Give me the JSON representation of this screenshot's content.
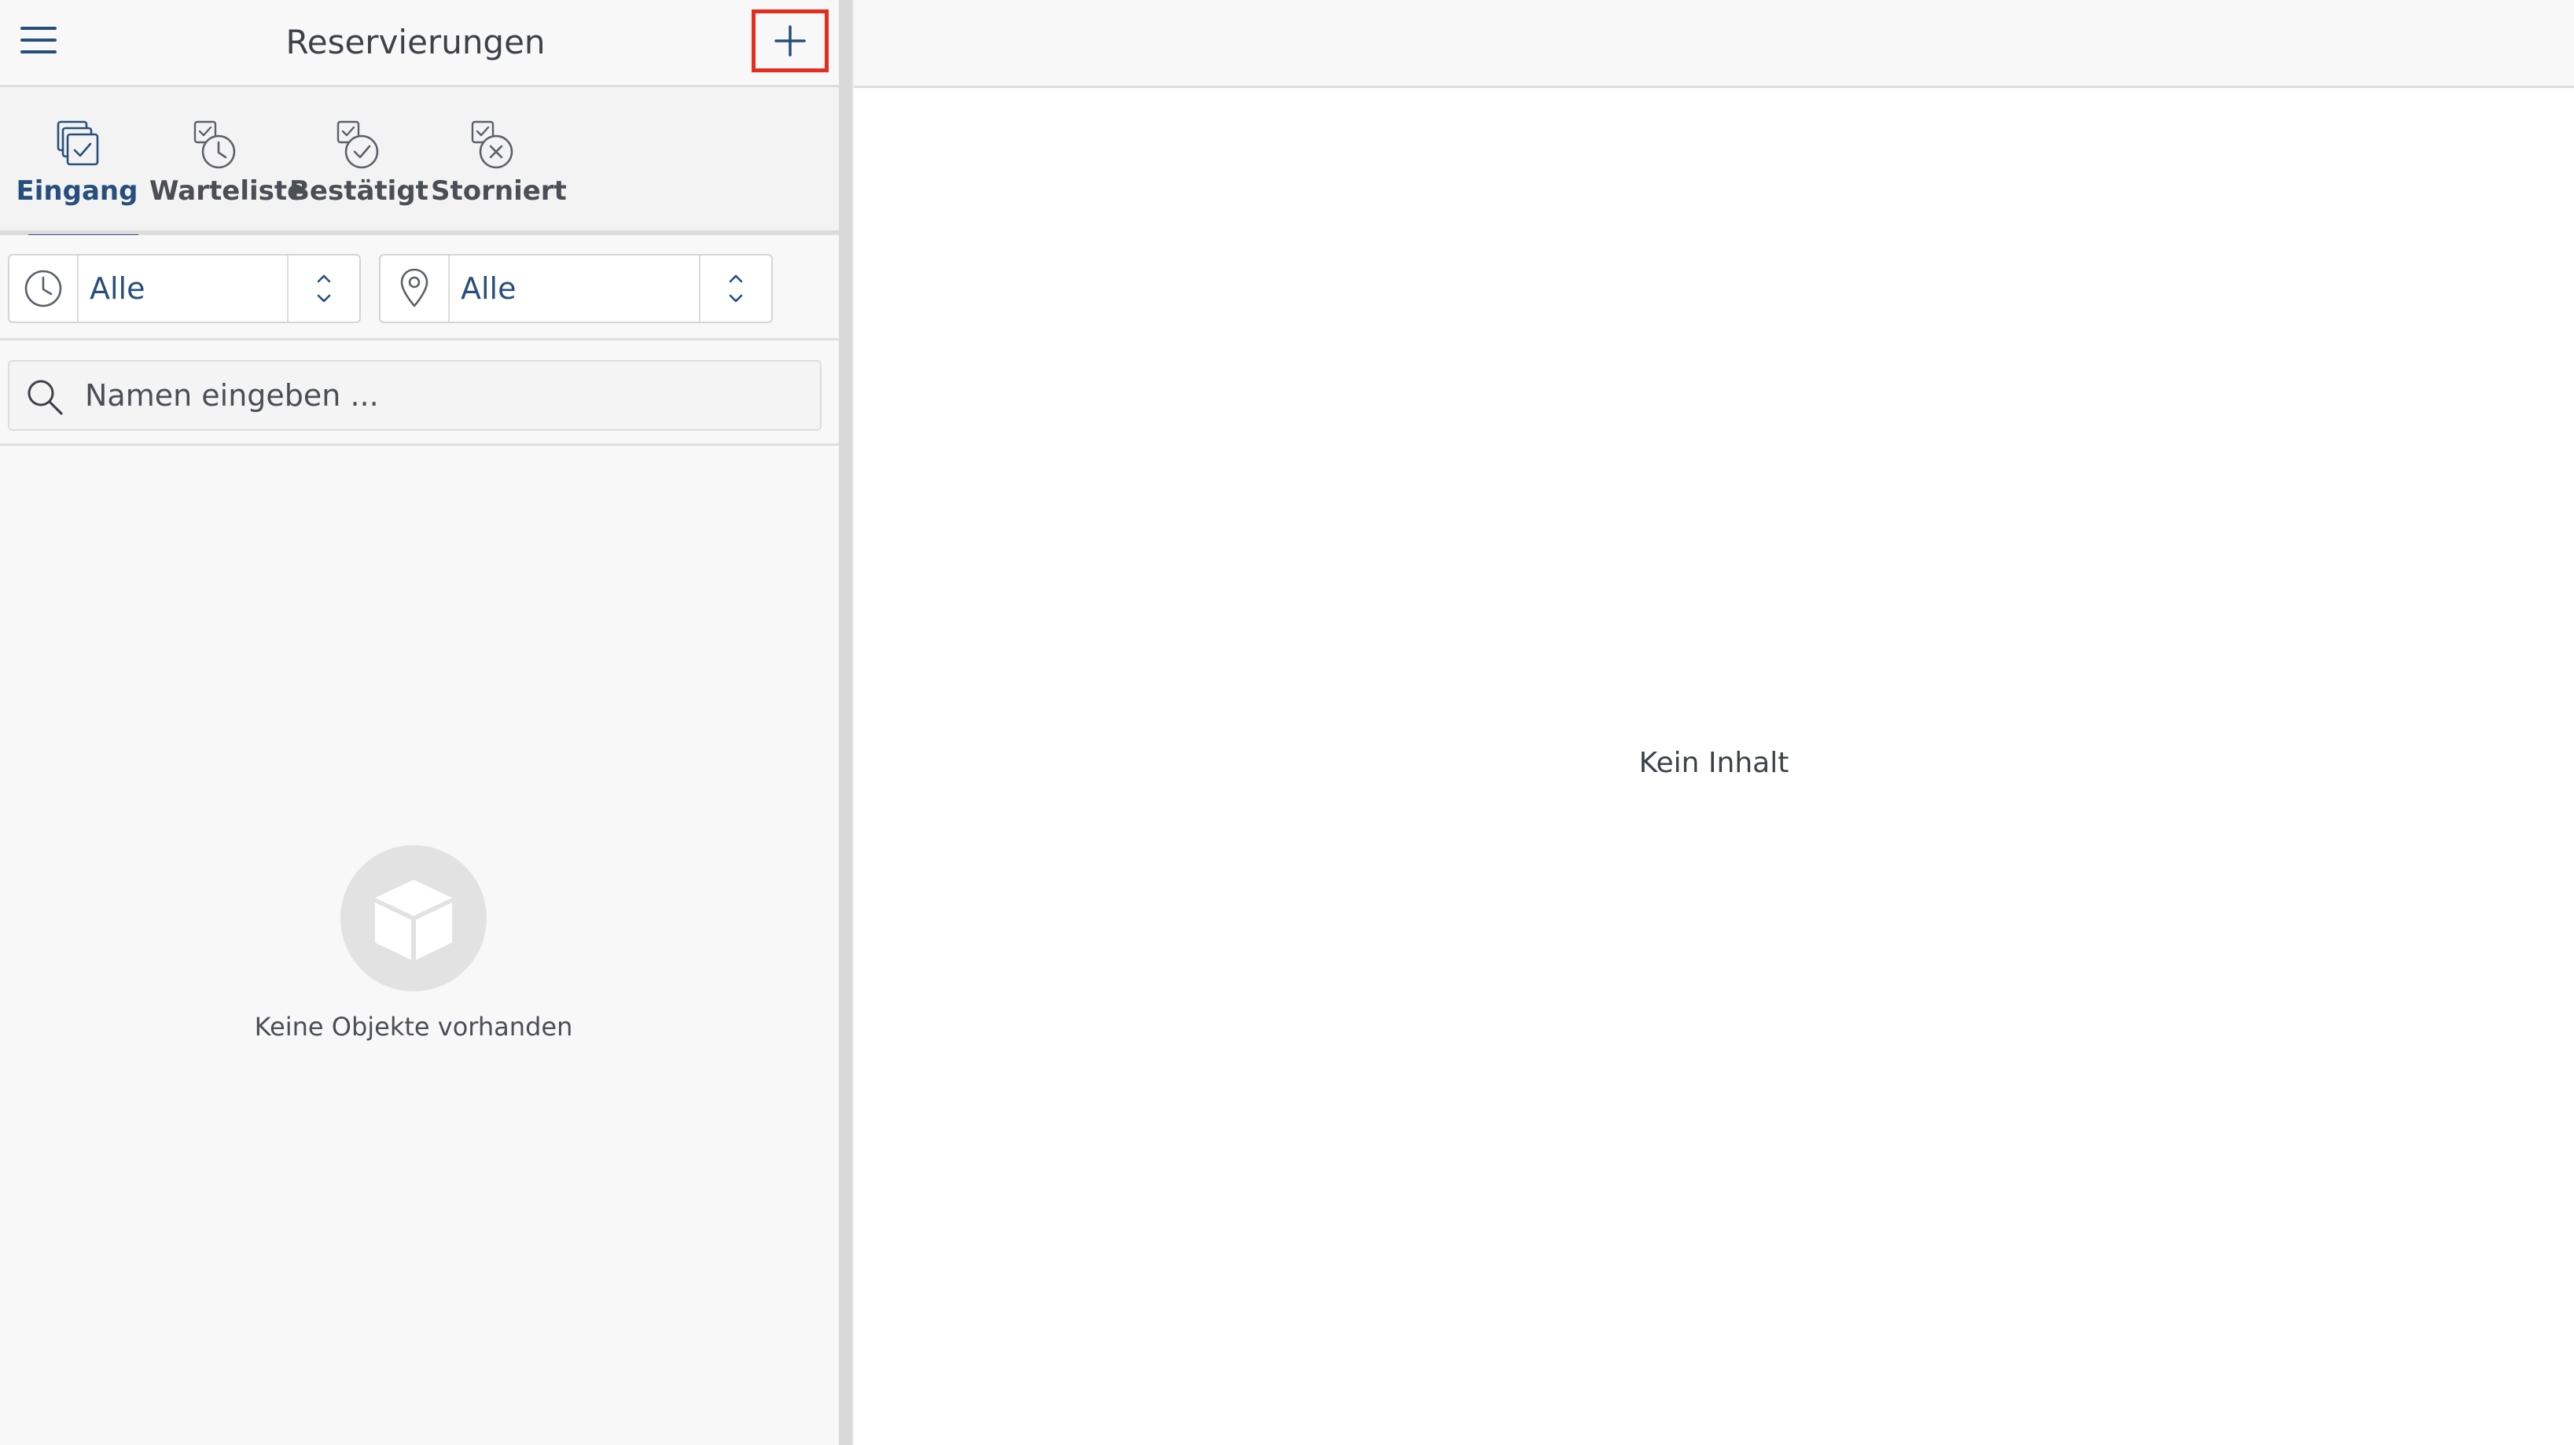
{
  "header": {
    "title": "Reservierungen",
    "menu_icon": "hamburger-menu-icon",
    "add_icon": "plus-icon",
    "highlight_color": "#e42d1e"
  },
  "tabs": [
    {
      "label": "Eingang",
      "icon": "inbox-stack-icon",
      "active": true
    },
    {
      "label": "Warteliste",
      "icon": "clock-waitlist-icon",
      "active": false
    },
    {
      "label": "Bestätigt",
      "icon": "check-circle-icon",
      "active": false
    },
    {
      "label": "Storniert",
      "icon": "cancel-circle-icon",
      "active": false
    }
  ],
  "filters": {
    "time": {
      "icon": "clock-icon",
      "value": "Alle"
    },
    "location": {
      "icon": "location-pin-icon",
      "value": "Alle"
    }
  },
  "search": {
    "placeholder": "Namen eingeben ...",
    "value": ""
  },
  "list": {
    "empty_icon": "box-icon",
    "empty_text": "Keine Objekte vorhanden"
  },
  "detail": {
    "empty_text": "Kein Inhalt"
  },
  "colors": {
    "accent": "#274f7e",
    "background": "#f8f8f8"
  }
}
